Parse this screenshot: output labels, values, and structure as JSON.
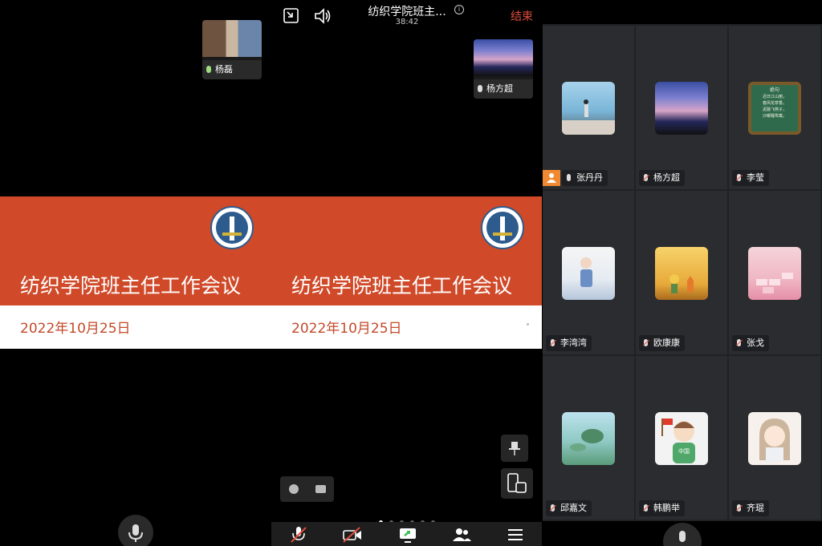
{
  "slide": {
    "title": "纺织学院班主任工作会议",
    "date": "2022年10月25日"
  },
  "left_panel": {
    "self_tile_name": "杨磊"
  },
  "meeting_header": {
    "title": "纺织学院班主...",
    "elapsed": "38:42",
    "info_glyph": "ⓘ",
    "end_label": "结束"
  },
  "mid_panel": {
    "speaker_tile_name": "杨方超",
    "page_count": 6,
    "active_page": 1
  },
  "participants": [
    {
      "name": "张丹丹",
      "host": true,
      "mic": "on",
      "avatar": "sea-photo"
    },
    {
      "name": "杨方超",
      "host": false,
      "mic": "off",
      "avatar": "sunset-photo"
    },
    {
      "name": "李莹",
      "host": false,
      "mic": "off",
      "avatar": "poem-board"
    },
    {
      "name": "李湾湾",
      "host": false,
      "mic": "off",
      "avatar": "baby-photo"
    },
    {
      "name": "欧康康",
      "host": false,
      "mic": "off",
      "avatar": "little-prince"
    },
    {
      "name": "张戈",
      "host": false,
      "mic": "off",
      "avatar": "pink-blocks"
    },
    {
      "name": "邱嘉文",
      "host": false,
      "mic": "off",
      "avatar": "lotus-painting"
    },
    {
      "name": "韩鹏举",
      "host": false,
      "mic": "off",
      "avatar": "cartoon-boy-flag"
    },
    {
      "name": "齐琨",
      "host": false,
      "mic": "off",
      "avatar": "cartoon-girl"
    }
  ],
  "board_text": {
    "title": "绝句",
    "lines": [
      "迟日江山丽，",
      "春风花草香。",
      "泥融飞燕子，",
      "沙暖睡鸳鸯。"
    ]
  },
  "avatar_text": {
    "boy_shirt": "中国"
  },
  "colors": {
    "slide_red": "#d04a29",
    "end_red": "#e24b3b",
    "host_orange": "#f08a32",
    "mic_active": "#9be07c"
  }
}
